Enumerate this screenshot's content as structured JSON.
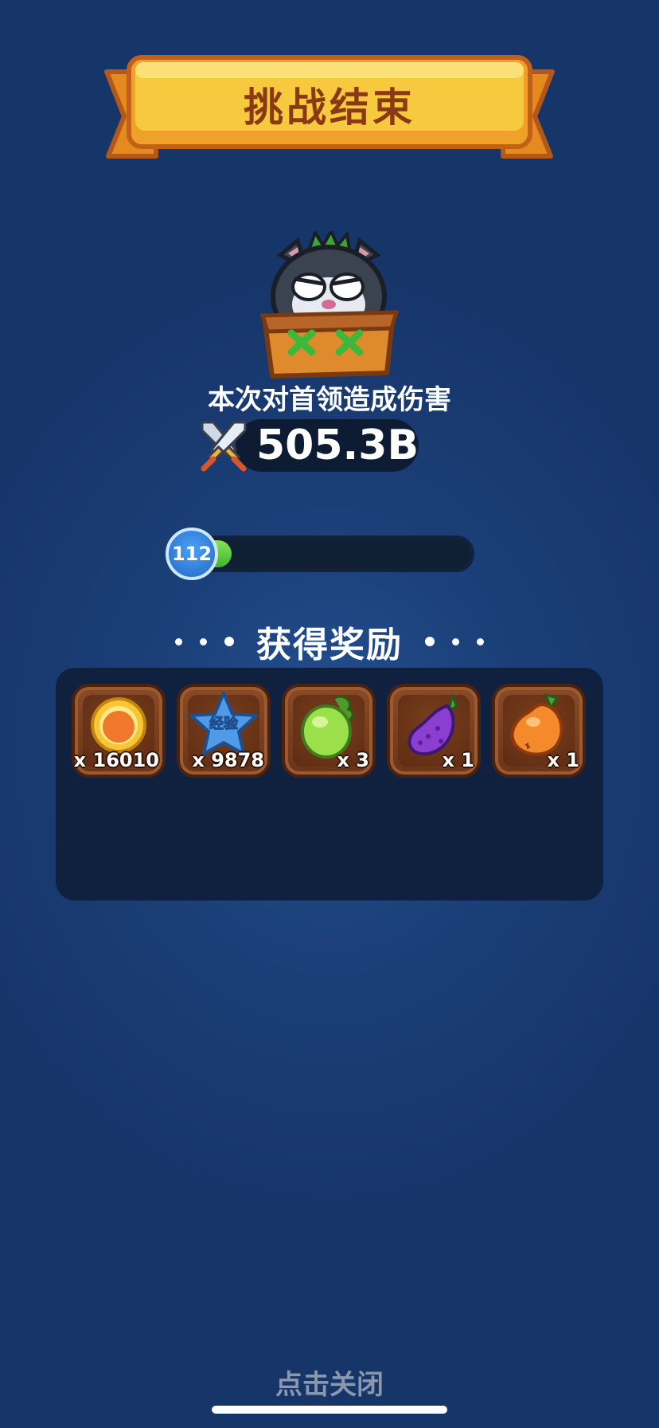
{
  "banner": {
    "title": "挑战结束"
  },
  "boss": {
    "name_icon": "boss-cat-icon"
  },
  "damage": {
    "label": "本次对首领造成伤害",
    "value": "505.3B",
    "icon": "crossed-swords-icon"
  },
  "level": {
    "number": "112",
    "progress": 0.13
  },
  "rewards": {
    "title": "获得奖励",
    "items": [
      {
        "icon": "gold-coin-icon",
        "qty": "x 16010"
      },
      {
        "icon": "exp-star-icon",
        "label": "经验",
        "qty": "x 9878"
      },
      {
        "icon": "green-fruit-icon",
        "qty": "x 3"
      },
      {
        "icon": "purple-eggplant-icon",
        "qty": "x 1"
      },
      {
        "icon": "orange-fruit-icon",
        "qty": "x 1"
      }
    ]
  },
  "footer": {
    "close_label": "点击关闭"
  },
  "colors": {
    "background": "#1b3f78",
    "banner": "#f6c93e",
    "banner_text": "#8a3a12",
    "progress": "#4cc236"
  }
}
